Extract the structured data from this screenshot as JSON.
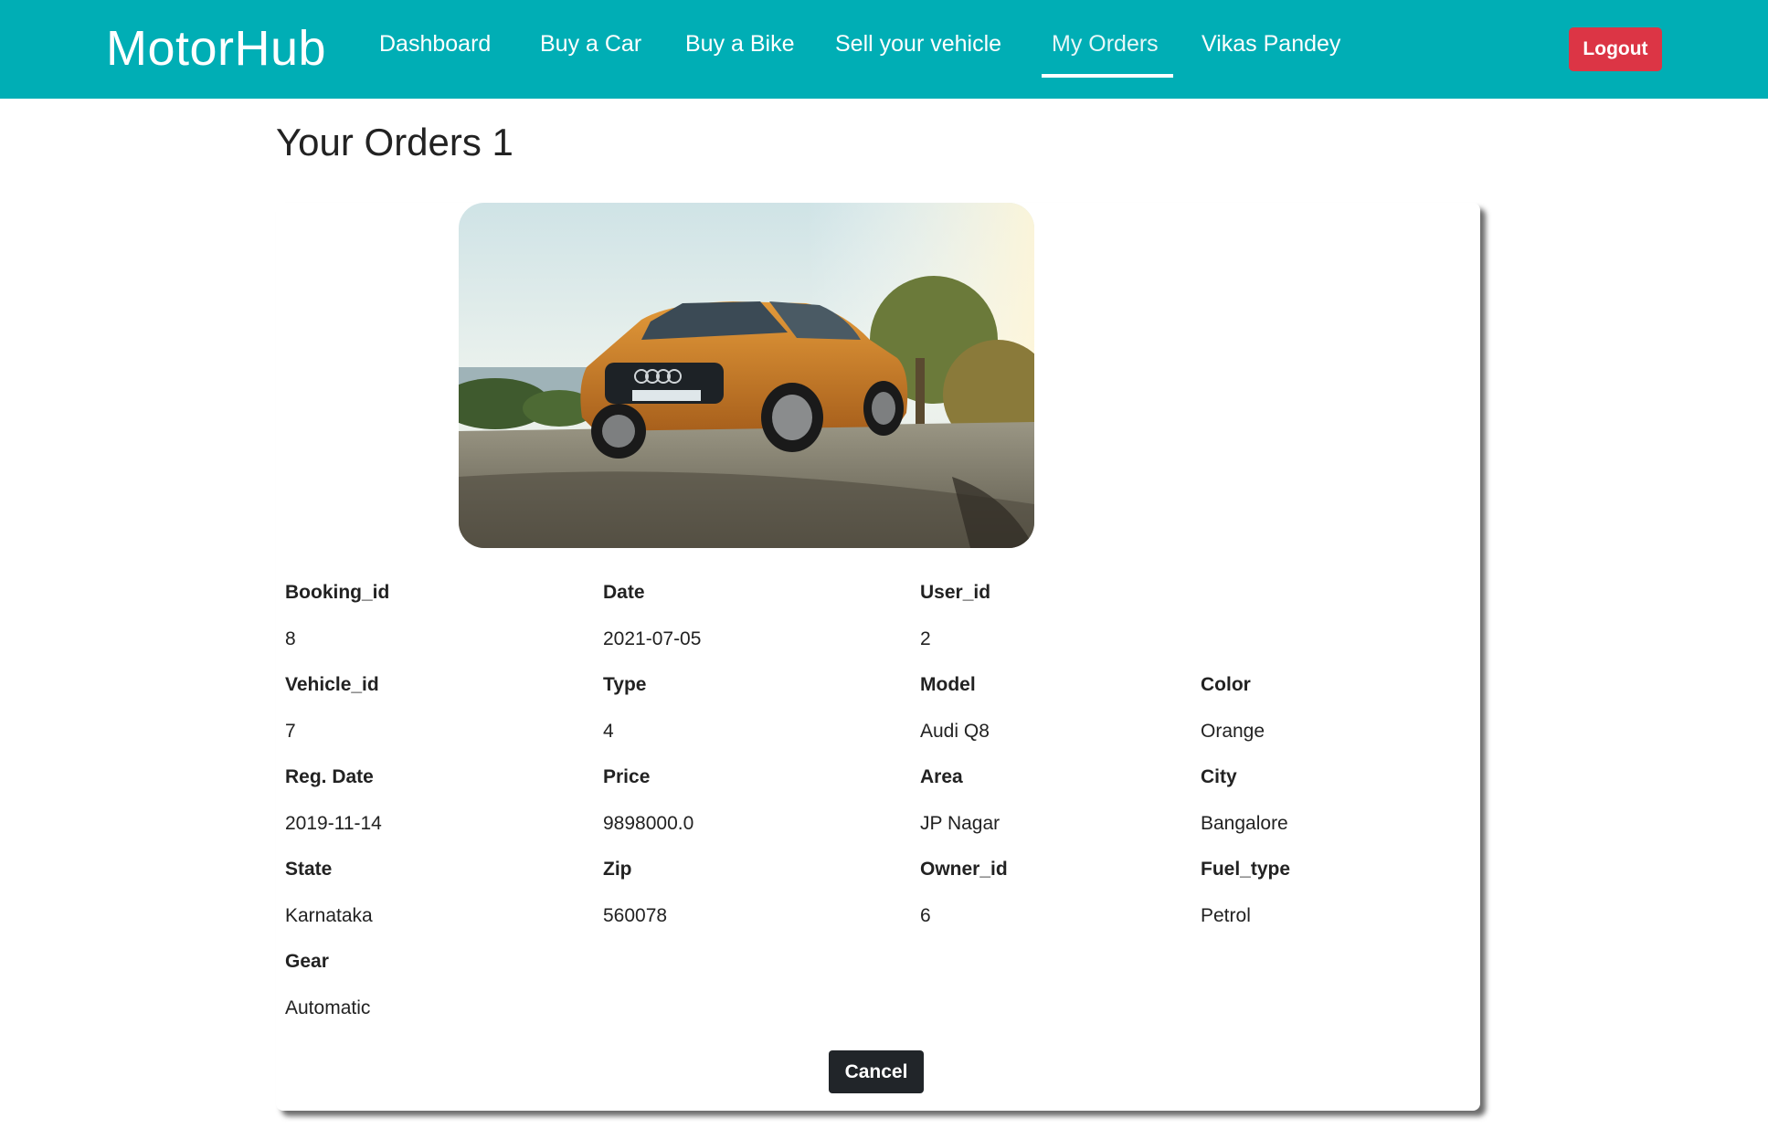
{
  "navbar": {
    "brand": "MotorHub",
    "links": [
      {
        "label": "Dashboard"
      },
      {
        "label": "Buy a Car"
      },
      {
        "label": "Buy a Bike"
      },
      {
        "label": "Sell your vehicle"
      },
      {
        "label": "My Orders",
        "active": true
      },
      {
        "label": "Vikas Pandey"
      }
    ],
    "logout_label": "Logout",
    "colors": {
      "background": "#00aeb5",
      "logout": "#dc3545"
    }
  },
  "page": {
    "title": "Your Orders 1"
  },
  "order": {
    "image_icon": "car-photo",
    "fields": {
      "booking_id": {
        "label": "Booking_id",
        "value": "8"
      },
      "date": {
        "label": "Date",
        "value": "2021-07-05"
      },
      "user_id": {
        "label": "User_id",
        "value": "2"
      },
      "vehicle_id": {
        "label": "Vehicle_id",
        "value": "7"
      },
      "type": {
        "label": "Type",
        "value": "4"
      },
      "model": {
        "label": "Model",
        "value": "Audi Q8"
      },
      "color": {
        "label": "Color",
        "value": "Orange"
      },
      "reg_date": {
        "label": "Reg. Date",
        "value": "2019-11-14"
      },
      "price": {
        "label": "Price",
        "value": "9898000.0"
      },
      "area": {
        "label": "Area",
        "value": "JP Nagar"
      },
      "city": {
        "label": "City",
        "value": "Bangalore"
      },
      "state": {
        "label": "State",
        "value": "Karnataka"
      },
      "zip": {
        "label": "Zip",
        "value": "560078"
      },
      "owner_id": {
        "label": "Owner_id",
        "value": "6"
      },
      "fuel_type": {
        "label": "Fuel_type",
        "value": "Petrol"
      },
      "gear": {
        "label": "Gear",
        "value": "Automatic"
      }
    },
    "cancel_label": "Cancel"
  }
}
